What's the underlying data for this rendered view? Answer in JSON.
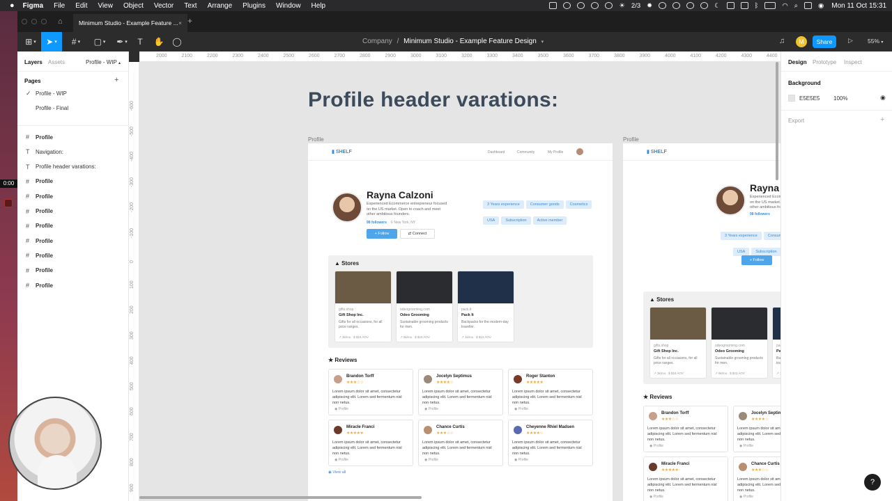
{
  "menubar": {
    "app": "Figma",
    "items": [
      "File",
      "Edit",
      "View",
      "Object",
      "Vector",
      "Text",
      "Arrange",
      "Plugins",
      "Window",
      "Help"
    ],
    "page_count": "2/3",
    "datetime": "Mon 11 Oct  15:31"
  },
  "recording": {
    "time": "0:00"
  },
  "tab": {
    "title": "Minimum Studio - Example Feature ..."
  },
  "toolbar": {
    "breadcrumb_team": "Company",
    "breadcrumb_sep": "/",
    "file_name": "Minimum Studio - Example Feature Design",
    "avatar_initial": "M",
    "share_label": "Share",
    "zoom": "55%"
  },
  "left_panel": {
    "tab_layers": "Layers",
    "tab_assets": "Assets",
    "current_page": "Profile - WIP",
    "pages_heading": "Pages",
    "pages": [
      {
        "label": "Profile - WIP",
        "check": "✓"
      },
      {
        "label": "Profile - Final",
        "check": ""
      }
    ],
    "layers": [
      {
        "icon": "#",
        "label": "Profile"
      },
      {
        "icon": "T",
        "label": "Navigation:"
      },
      {
        "icon": "T",
        "label": "Profile header varations:"
      },
      {
        "icon": "#",
        "label": "Profile"
      },
      {
        "icon": "#",
        "label": "Profile"
      },
      {
        "icon": "#",
        "label": "Profile"
      },
      {
        "icon": "#",
        "label": "Profile"
      },
      {
        "icon": "#",
        "label": "Profile"
      },
      {
        "icon": "#",
        "label": "Profile"
      },
      {
        "icon": "#",
        "label": "Profile"
      },
      {
        "icon": "#",
        "label": "Profile"
      }
    ]
  },
  "ruler": {
    "top": [
      "2000",
      "2100",
      "2200",
      "2300",
      "2400",
      "2500",
      "2600",
      "2700",
      "2800",
      "2900",
      "3000",
      "3100",
      "3200",
      "3300",
      "3400",
      "3500",
      "3600",
      "3700",
      "3800",
      "3900",
      "4000",
      "4100",
      "4200",
      "4300",
      "4400"
    ],
    "left": [
      "-600",
      "-500",
      "-400",
      "-300",
      "-200",
      "-100",
      "0",
      "100",
      "200",
      "300",
      "400",
      "500",
      "600",
      "700",
      "800",
      "900",
      "1000"
    ]
  },
  "right_panel": {
    "tabs": [
      "Design",
      "Prototype",
      "Inspect"
    ],
    "background_label": "Background",
    "bg_hex": "E5E5E5",
    "bg_opacity": "100%",
    "export_label": "Export"
  },
  "canvas": {
    "heading": "Profile header varations:",
    "frame1_label": "Profile",
    "frame2_label": "Profile"
  },
  "profile": {
    "logo": "SHELF",
    "nav": [
      "Dashboard",
      "Community",
      "My Profile"
    ],
    "name": "Rayna Calzoni",
    "bio": "Experienced Ecommerce entrepreneur focused on the US market. Open to coach and meet other ambitious founders.",
    "followers": "98 followers",
    "location": "New York, NY",
    "follow_label": "Follow",
    "connect_label": "Connect",
    "chips": [
      "3 Years experience",
      "Consumer goods",
      "Cosmetics",
      "USA",
      "Subscription",
      "Active member"
    ],
    "stores_title": "Stores",
    "stores": [
      {
        "domain": "gifts.shop",
        "name": "Gift Shop Inc.",
        "desc": "Gifts for all occasions, for all price ranges.",
        "metric1": "3k/mo",
        "metric2": "$18 AOV",
        "color": "#6b5a44"
      },
      {
        "domain": "odeogrooming.com",
        "name": "Odeo Grooming",
        "desc": "Sustainable grooming products for men.",
        "metric1": "6k/mo",
        "metric2": "$23 AOV",
        "color": "#2a2c2f"
      },
      {
        "domain": "pack.it",
        "name": "Pack It",
        "desc": "Backpacks for the modern-day traveller.",
        "metric1": "1k/mo",
        "metric2": "$13 AOV",
        "color": "#203048"
      }
    ],
    "reviews_title": "Reviews",
    "reviews": [
      {
        "name": "Brandon Torff",
        "stars": "★★★☆☆",
        "body": "Lorem ipsum dolor sit amet, consectetur adipiscing elit. Lorem sed fermentum nisl non netus.",
        "tag": "Profile"
      },
      {
        "name": "Jocelyn Septimus",
        "stars": "★★★★☆",
        "body": "Lorem ipsum dolor sit amet, consectetur adipiscing elit. Lorem sed fermentum nisl non netus.",
        "tag": "Profile"
      },
      {
        "name": "Roger Stanton",
        "stars": "★★★★★",
        "body": "Lorem ipsum dolor sit amet, consectetur adipiscing elit. Lorem sed fermentum nisl non netus.",
        "tag": "Profile"
      },
      {
        "name": "Miracle Franci",
        "stars": "★★★★★",
        "body": "Lorem ipsum dolor sit amet, consectetur adipiscing elit. Lorem sed fermentum nisl non netus.",
        "tag": "Profile"
      },
      {
        "name": "Chance Curtis",
        "stars": "★★★☆☆",
        "body": "Lorem ipsum dolor sit amet, consectetur adipiscing elit. Lorem sed fermentum nisl non netus.",
        "tag": "Profile"
      },
      {
        "name": "Cheyenne Rhiel Madsen",
        "stars": "★★★★☆",
        "body": "Lorem ipsum dolor sit amet, consectetur adipiscing elit. Lorem sed fermentum nisl non netus.",
        "tag": "Profile"
      }
    ],
    "view_all": "View all"
  },
  "help_label": "?"
}
